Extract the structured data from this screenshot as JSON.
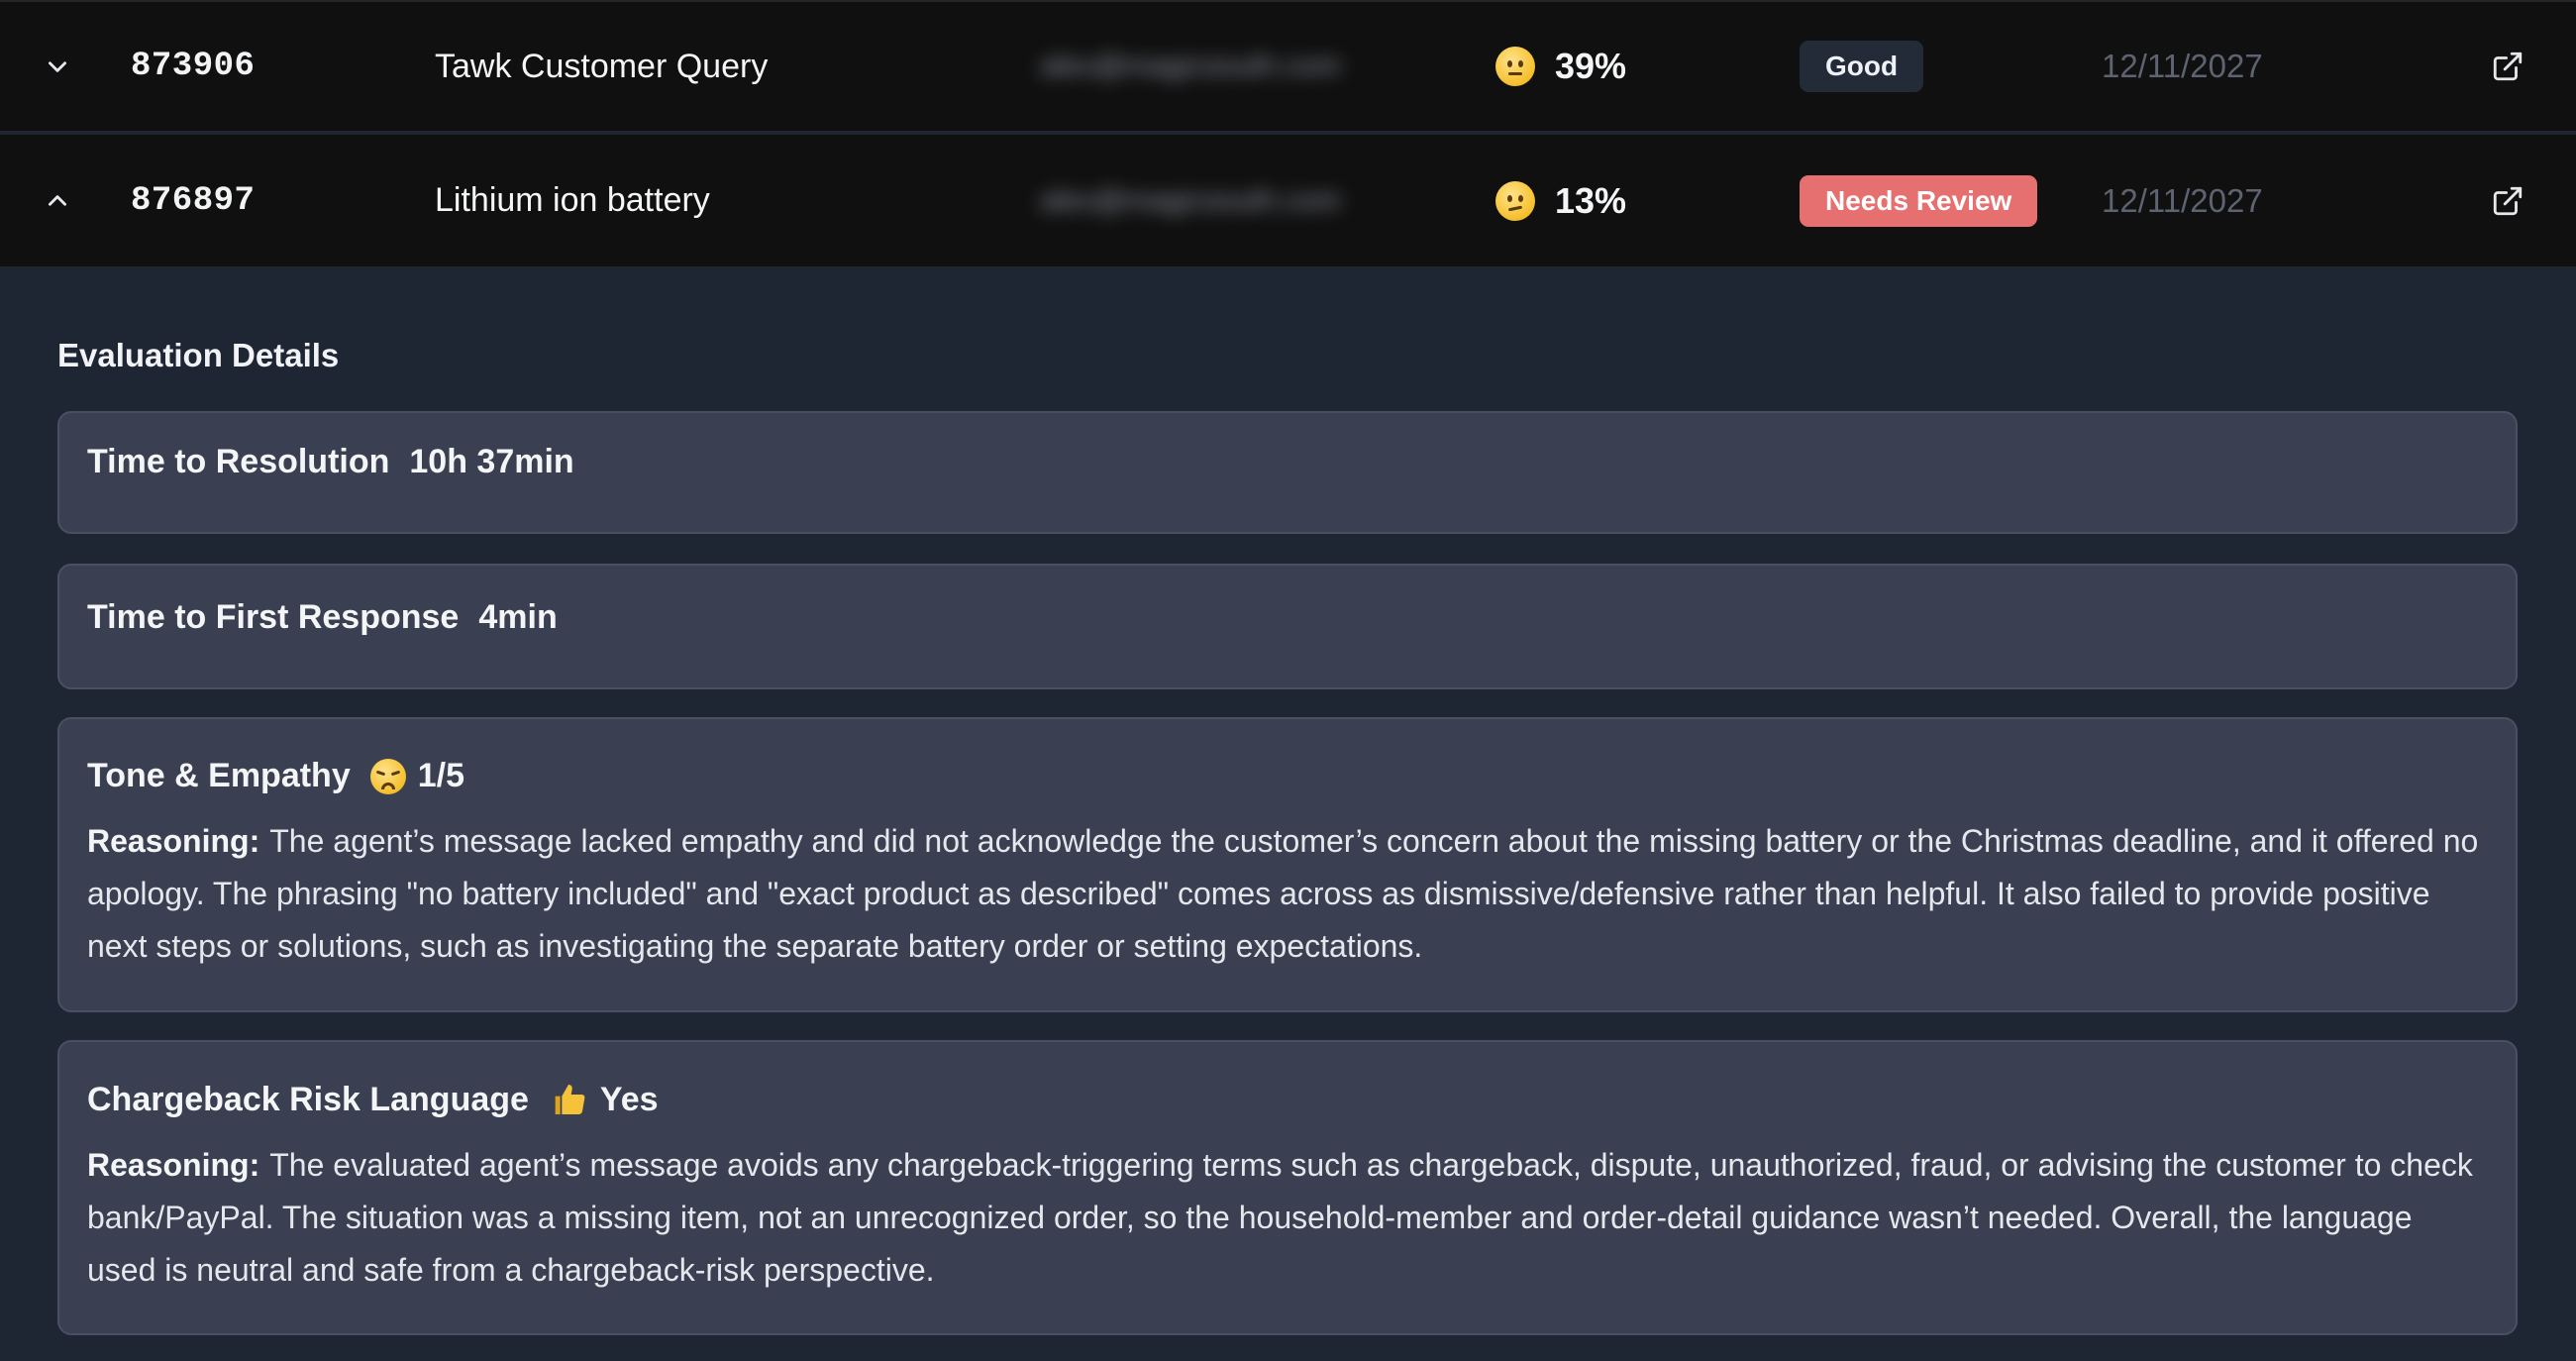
{
  "tickets": [
    {
      "id": "873906",
      "subject": "Tawk Customer Query",
      "email": "alex@magicsouth.com",
      "score": "39%",
      "score_icon": "neutral-face-icon",
      "status": "Good",
      "date": "12/11/2027",
      "expanded": false
    },
    {
      "id": "876897",
      "subject": "Lithium ion battery",
      "email": "alex@magicsouth.com",
      "score": "13%",
      "score_icon": "confused-face-icon",
      "status": "Needs Review",
      "date": "12/11/2027",
      "expanded": true
    }
  ],
  "details": {
    "title": "Evaluation Details",
    "time_to_resolution": {
      "label": "Time to Resolution",
      "value": "10h 37min"
    },
    "time_to_first_response": {
      "label": "Time to First Response",
      "value": "4min"
    },
    "tone_empathy": {
      "label": "Tone & Empathy",
      "icon": "disappointed-face-icon",
      "value": "1/5",
      "reasoning_label": "Reasoning:",
      "reasoning": "The agent’s message lacked empathy and did not acknowledge the customer’s concern about the missing battery or the Christmas deadline, and it offered no apology. The phrasing \"no battery included\" and \"exact product as described\" comes across as dismissive/defensive rather than helpful. It also failed to provide positive next steps or solutions, such as investigating the separate battery order or setting expectations."
    },
    "chargeback_risk": {
      "label": "Chargeback Risk Language",
      "icon": "thumbs-up-icon",
      "value": "Yes",
      "reasoning_label": "Reasoning:",
      "reasoning": "The evaluated agent’s message avoids any chargeback-triggering terms such as chargeback, dispute, unauthorized, fraud, or advising the customer to check bank/PayPal. The situation was a missing item, not an unrecognized order, so the household-member and order-detail guidance wasn’t needed. Overall, the language used is neutral and safe from a chargeback-risk perspective."
    }
  },
  "colors": {
    "row_bg": "#101010",
    "panel_bg": "#1e2533",
    "card_bg": "#3a4051",
    "badge_good": "#232b38",
    "badge_review": "#e66f6f",
    "date_text": "#5d6370"
  }
}
